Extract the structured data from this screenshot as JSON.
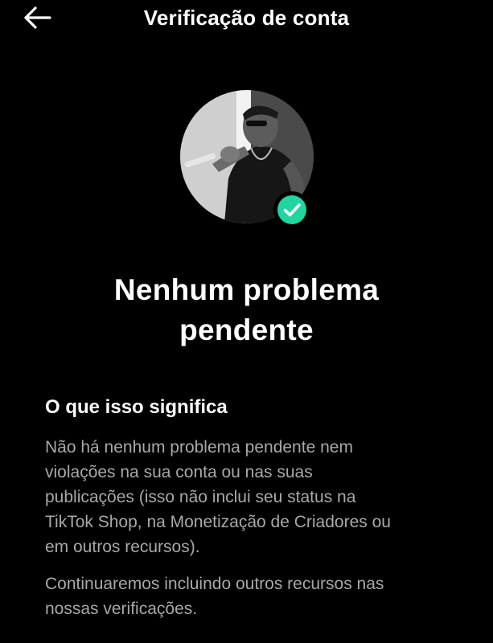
{
  "header": {
    "title": "Verificação de conta",
    "back_icon": "arrow-left-icon"
  },
  "profile": {
    "avatar_icon": "profile-photo",
    "badge_icon": "check-circle-icon",
    "badge_color": "#20D5A0"
  },
  "status": {
    "headline_line1": "Nenhum problema",
    "headline_line2": "pendente"
  },
  "info": {
    "title": "O que isso significa",
    "paragraph1_line1": "Não há nenhum problema pendente nem",
    "paragraph1_line2": "violações na sua conta ou nas suas",
    "paragraph1_line3": "publicações (isso não inclui seu status na",
    "paragraph1_line4": "TikTok Shop, na Monetização de Criadores ou",
    "paragraph1_line5": "em outros recursos).",
    "paragraph2_line1": "Continuaremos incluindo outros recursos nas",
    "paragraph2_line2": "nossas verificações."
  }
}
